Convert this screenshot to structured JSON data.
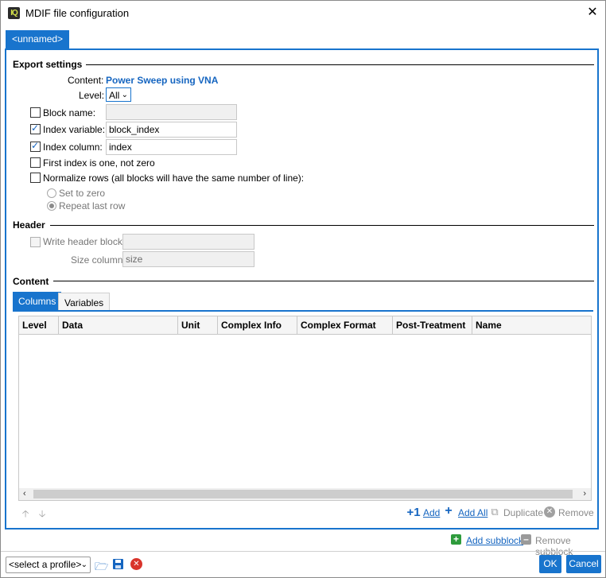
{
  "window": {
    "title": "MDIF file configuration",
    "app_icon": "IQ",
    "close_glyph": "✕"
  },
  "profile_tab": "<unnamed>",
  "export_settings": {
    "title": "Export settings",
    "content_label": "Content:",
    "content_value": "Power Sweep using VNA",
    "level_label": "Level:",
    "level_value": "All",
    "block_name": {
      "label": "Block name:",
      "checked": false,
      "value": ""
    },
    "index_variable": {
      "label": "Index variable:",
      "checked": true,
      "value": "block_index"
    },
    "index_column": {
      "label": "Index column:",
      "checked": true,
      "value": "index"
    },
    "first_index": {
      "label": "First index is one, not zero",
      "checked": false
    },
    "normalize_rows": {
      "label": "Normalize rows (all blocks will have the same number of line):",
      "checked": false
    },
    "radio_set_zero": "Set to zero",
    "radio_repeat_last": "Repeat last row"
  },
  "header": {
    "title": "Header",
    "write_header_label": "Write header block:",
    "write_header_value": "",
    "size_column_label": "Size column:",
    "size_column_value": "size"
  },
  "content": {
    "title": "Content",
    "tabs": [
      "Columns",
      "Variables"
    ],
    "columns": [
      "Level",
      "Data",
      "Unit",
      "Complex Info",
      "Complex Format",
      "Post-Treatment",
      "Name"
    ]
  },
  "toolbar": {
    "add": "Add",
    "add_all": "Add All",
    "duplicate": "Duplicate",
    "remove": "Remove",
    "add_subblock": "Add subblock",
    "remove_subblock": "Remove subblock"
  },
  "footer": {
    "profile_select": "<select a profile>",
    "ok": "OK",
    "cancel": "Cancel"
  },
  "colors": {
    "accent": "#1874cd",
    "link": "#1565c0",
    "add_green": "#2e9b3c",
    "delete_red": "#d9342b"
  }
}
